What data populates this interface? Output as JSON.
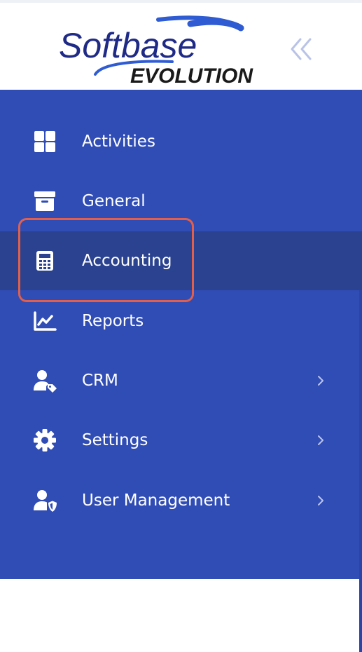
{
  "brand": {
    "name_line1": "Softbase",
    "name_line2": "EVOLUTION",
    "colors": {
      "logo_blue": "#1f2a86",
      "swoosh_blue": "#2f5bd3",
      "collapse_icon": "#b9c3e8"
    }
  },
  "header": {
    "collapse_icon": "double-chevron-left-icon"
  },
  "sidebar": {
    "background": "#304db6",
    "active_background": "#2a428f",
    "highlight_color": "#e2604b",
    "items": [
      {
        "label": "Activities",
        "icon": "grid-icon",
        "active": false,
        "has_submenu": false
      },
      {
        "label": "General",
        "icon": "archive-icon",
        "active": false,
        "has_submenu": false
      },
      {
        "label": "Accounting",
        "icon": "calculator-icon",
        "active": true,
        "has_submenu": false
      },
      {
        "label": "Reports",
        "icon": "chart-line-icon",
        "active": false,
        "has_submenu": false
      },
      {
        "label": "CRM",
        "icon": "user-tag-icon",
        "active": false,
        "has_submenu": true
      },
      {
        "label": "Settings",
        "icon": "gear-icon",
        "active": false,
        "has_submenu": true
      },
      {
        "label": "User Management",
        "icon": "user-shield-icon",
        "active": false,
        "has_submenu": true
      }
    ]
  }
}
